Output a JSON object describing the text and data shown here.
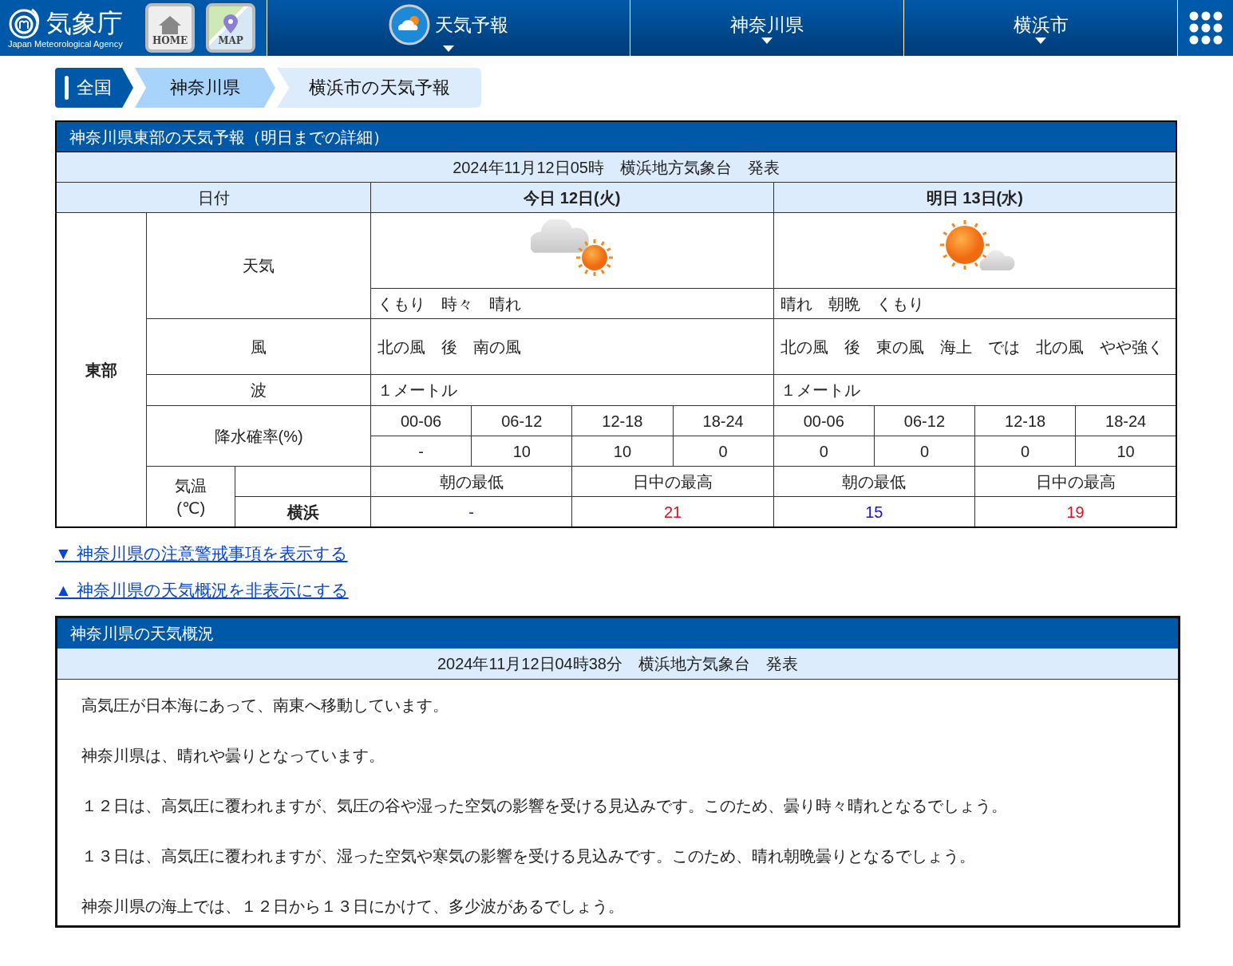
{
  "header": {
    "logo": {
      "name": "気象庁",
      "subtitle": "Japan Meteorological Agency"
    },
    "buttons": [
      {
        "label": "HOME",
        "kind": "home"
      },
      {
        "label": "MAP",
        "kind": "map"
      }
    ],
    "nav": [
      {
        "label": "天気予報",
        "kind": "forecast"
      },
      {
        "label": "神奈川県",
        "kind": "plain"
      },
      {
        "label": "横浜市",
        "kind": "plain"
      }
    ]
  },
  "breadcrumb": [
    "全国",
    "神奈川県",
    "横浜市の天気予報"
  ],
  "forecast": {
    "title": "神奈川県東部の天気予報（明日までの詳細）",
    "issued": "2024年11月12日05時　横浜地方気象台　発表",
    "date_label": "日付",
    "area": "東部",
    "row_labels": {
      "weather": "天気",
      "wind": "風",
      "wave": "波",
      "pop": "降水確率(%)",
      "temp": "気温",
      "temp_unit": "(℃)"
    },
    "station": "横浜",
    "days": [
      {
        "label": "今日 12日(火)",
        "kind": "cloudy-sunny",
        "weather": "くもり　時々　晴れ",
        "wind": "北の風　後　南の風",
        "wave": "１メートル",
        "pop": [
          {
            "period": "00-06",
            "value": "-"
          },
          {
            "period": "06-12",
            "value": "10"
          },
          {
            "period": "12-18",
            "value": "10"
          },
          {
            "period": "18-24",
            "value": "0"
          }
        ],
        "temps": [
          {
            "label": "朝の最低",
            "value": "-",
            "kind": "min"
          },
          {
            "label": "日中の最高",
            "value": "21",
            "kind": "max"
          }
        ]
      },
      {
        "label": "明日 13日(水)",
        "kind": "sunny-cloudy",
        "weather": "晴れ　朝晩　くもり",
        "wind": "北の風　後　東の風　海上　では　北の風　やや強く",
        "wave": "１メートル",
        "pop": [
          {
            "period": "00-06",
            "value": "0"
          },
          {
            "period": "06-12",
            "value": "0"
          },
          {
            "period": "12-18",
            "value": "0"
          },
          {
            "period": "18-24",
            "value": "10"
          }
        ],
        "temps": [
          {
            "label": "朝の最低",
            "value": "15",
            "kind": "min"
          },
          {
            "label": "日中の最高",
            "value": "19",
            "kind": "max"
          }
        ]
      }
    ]
  },
  "links": [
    "▼ 神奈川県の注意警戒事項を表示する",
    "▲ 神奈川県の天気概況を非表示にする"
  ],
  "overview": {
    "title": "神奈川県の天気概況",
    "issued": "2024年11月12日04時38分　横浜地方気象台　発表",
    "paragraphs": [
      "高気圧が日本海にあって、南東へ移動しています。",
      "神奈川県は、晴れや曇りとなっています。",
      "１２日は、高気圧に覆われますが、気圧の谷や湿った空気の影響を受ける見込みです。このため、曇り時々晴れとなるでしょう。",
      "１３日は、高気圧に覆われますが、湿った空気や寒気の影響を受ける見込みです。このため、晴れ朝晩曇りとなるでしょう。",
      "神奈川県の海上では、１２日から１３日にかけて、多少波があるでしょう。"
    ]
  }
}
